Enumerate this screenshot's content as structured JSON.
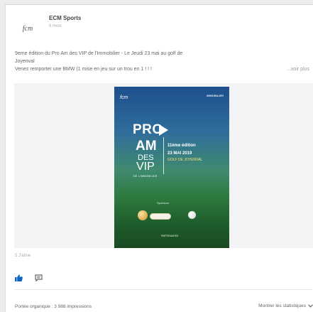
{
  "header": {
    "company_name": "ECM Sports",
    "time": "8 mois",
    "avatar_text": "fcm"
  },
  "post": {
    "line1": "9eme édition du Pro Am des VIP de l'Immobilier - Le Jeudi 23 mai au golf de",
    "line2": "Joyenval",
    "line3": "Venez remporter une BMW (1 mise en jeu sur un trou en 1 ! ! !",
    "more": "...voir plus"
  },
  "poster": {
    "logo": "fcm",
    "partner": "IMMOBILIER",
    "pro": "PRO",
    "am": "AM",
    "des": "DES",
    "vip": "VIP",
    "immo": "DE L'IMMOBILIER",
    "edition": "11ème édition",
    "date": "23 MAI 2019",
    "golf": "GOLF DE JOYENVAL",
    "sponsor": "Sponsors",
    "footer": "PARTENAIRES"
  },
  "reactions": {
    "count": "5 J'aime"
  },
  "footer": {
    "reach": "Portée organique : 3 988 impressions",
    "stats_link": "Montrer les statistiques"
  },
  "colors": {
    "like": "#0a66c2",
    "text": "#666666",
    "media_bg": "#f2f3f5"
  },
  "icons": [
    "like-icon",
    "comment-icon",
    "chevron-down-icon"
  ]
}
